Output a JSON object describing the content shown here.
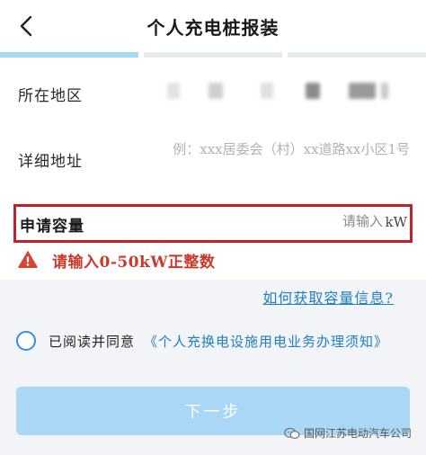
{
  "header": {
    "title": "个人充电桩报装"
  },
  "progress": {
    "active_steps": 1,
    "total_steps": 3
  },
  "form": {
    "region": {
      "label": "所在地区"
    },
    "address": {
      "label": "详细地址",
      "placeholder": "例：xxx居委会（村）xx道路xx小区1号"
    },
    "capacity": {
      "label": "申请容量",
      "placeholder": "请输入",
      "unit": "kW",
      "value": ""
    },
    "error": {
      "text": "请输入0-50kW正整数"
    }
  },
  "help_link": {
    "text": "如何获取容量信息?"
  },
  "agreement": {
    "text": "已阅读并同意",
    "link": "《个人充换电设施用电业务办理须知》"
  },
  "next_button": {
    "label": "下一步"
  },
  "watermark": {
    "text": "国网江苏电动汽车公司"
  },
  "colors": {
    "accent": "#1e7fc2",
    "error": "#c93a2b",
    "highlight_border": "#c0222a",
    "button": "#a9d7f5"
  }
}
